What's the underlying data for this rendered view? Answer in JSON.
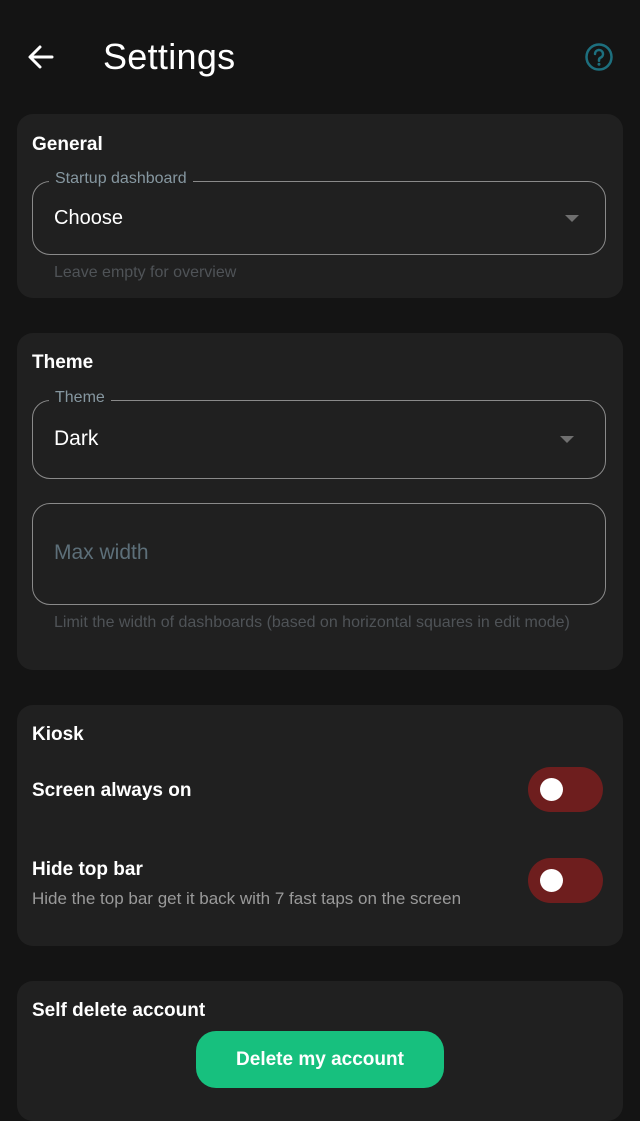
{
  "appbar": {
    "title": "Settings",
    "back_icon": "arrow-left-icon",
    "help_icon": "help-circle-icon",
    "help_color": "#1d6f7e"
  },
  "general": {
    "title": "General",
    "dashboard_label": "Startup dashboard",
    "dashboard_value": "Choose",
    "dashboard_helper": "Leave empty for overview"
  },
  "theme": {
    "title": "Theme",
    "theme_label": "Theme",
    "theme_value": "Dark",
    "max_width_placeholder": "Max width",
    "max_width_value": "",
    "max_width_helper": "Limit the width of dashboards (based on horizontal squares in edit mode)"
  },
  "kiosk": {
    "title": "Kiosk",
    "screen_on_label": "Screen always on",
    "screen_on_enabled": false,
    "hide_top_bar_label": "Hide top bar",
    "hide_top_bar_sub": "Hide the top bar get it back with 7 fast taps on the screen",
    "hide_top_bar_enabled": false,
    "toggle_off_color": "#6e1e1e"
  },
  "account": {
    "title": "Self delete account",
    "delete_label": "Delete my account",
    "button_color": "#17c07e"
  }
}
